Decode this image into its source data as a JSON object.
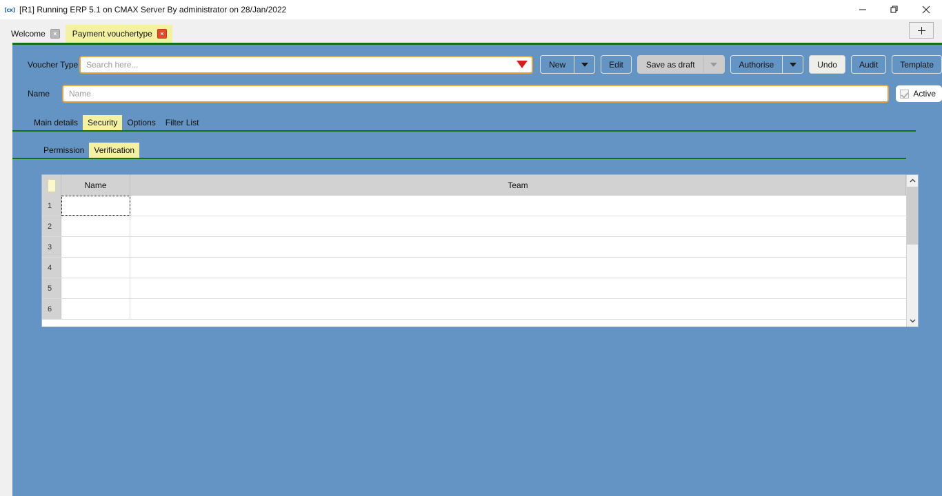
{
  "window": {
    "icon": "app-logo-icon",
    "title": "[R1] Running ERP 5.1 on CMAX Server By administrator on 28/Jan/2022",
    "controls": {
      "minimize": "minimize-icon",
      "maximize": "restore-icon",
      "close": "close-icon"
    }
  },
  "tabstrip": {
    "tabs": [
      {
        "label": "Welcome",
        "active": false,
        "close": "×"
      },
      {
        "label": "Payment vouchertype",
        "active": true,
        "close": "×"
      }
    ],
    "new_tab_label": "+"
  },
  "form": {
    "voucher_type": {
      "label": "Voucher Type",
      "value": "",
      "placeholder": "Search here...",
      "dropdown_icon": "triangle-down-icon"
    },
    "name": {
      "label": "Name",
      "value": "",
      "placeholder": "Name"
    },
    "active": {
      "label": "Active",
      "checked": true,
      "disabled": true
    }
  },
  "toolbar": {
    "new": {
      "label": "New",
      "has_dropdown": true,
      "disabled": false
    },
    "edit": {
      "label": "Edit",
      "disabled": false
    },
    "save_as_draft": {
      "label": "Save as draft",
      "has_dropdown": true,
      "disabled": true
    },
    "authorise": {
      "label": "Authorise",
      "has_dropdown": true,
      "disabled": false
    },
    "undo": {
      "label": "Undo",
      "disabled": false
    },
    "audit": {
      "label": "Audit",
      "disabled": false
    },
    "template": {
      "label": "Template",
      "disabled": false
    }
  },
  "tabs_primary": {
    "items": [
      {
        "label": "Main details",
        "selected": false
      },
      {
        "label": "Security",
        "selected": true
      },
      {
        "label": "Options",
        "selected": false
      },
      {
        "label": "Filter List",
        "selected": false
      }
    ]
  },
  "tabs_secondary": {
    "items": [
      {
        "label": "Permission",
        "selected": false
      },
      {
        "label": "Verification",
        "selected": true
      }
    ]
  },
  "grid": {
    "columns": [
      {
        "key": "index",
        "label": ""
      },
      {
        "key": "name",
        "label": "Name"
      },
      {
        "key": "team",
        "label": "Team"
      }
    ],
    "rows": [
      {
        "index": "1",
        "name": "",
        "team": "",
        "focused": true
      },
      {
        "index": "2",
        "name": "",
        "team": "",
        "focused": false
      },
      {
        "index": "3",
        "name": "",
        "team": "",
        "focused": false
      },
      {
        "index": "4",
        "name": "",
        "team": "",
        "focused": false
      },
      {
        "index": "5",
        "name": "",
        "team": "",
        "focused": false
      },
      {
        "index": "6",
        "name": "",
        "team": "",
        "focused": false
      }
    ],
    "scrollbar": {
      "up_icon": "chevron-up-icon",
      "down_icon": "chevron-down-icon",
      "thumb_ratio": "45%"
    }
  },
  "colors": {
    "app_background": "#6494c4",
    "tab_selected": "#f4f2a0",
    "accent_border": "#e8a33d",
    "separator_green": "#137012",
    "dropdown_red": "#d81f1f",
    "grid_header": "#d2d2d2"
  }
}
